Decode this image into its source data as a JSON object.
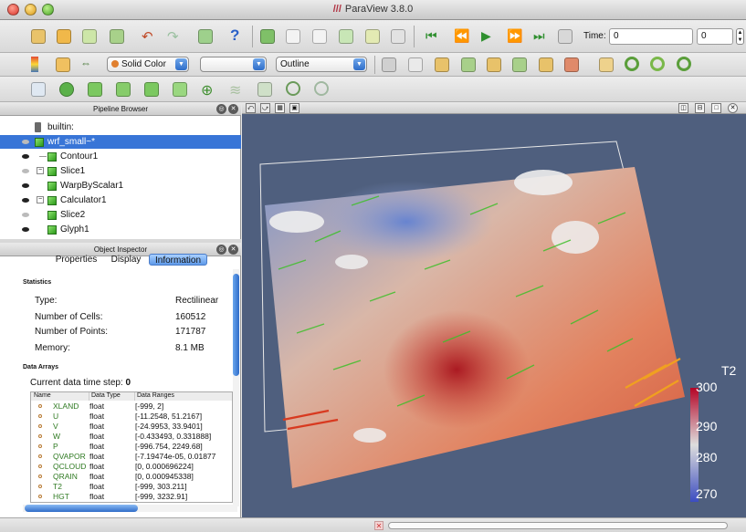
{
  "window": {
    "title": "ParaView 3.8.0"
  },
  "toolbar_main": {
    "time_label": "Time:",
    "time_value": "0",
    "timestep_value": "0",
    "icons": [
      "open-icon",
      "open-folder-icon",
      "load-state-icon",
      "save-state-icon",
      "undo-icon",
      "redo-icon",
      "connect-icon",
      "help-icon",
      "interact-icon",
      "select-cells-icon",
      "select-points-icon",
      "select-frustum-icon",
      "select-block-icon",
      "select-mode-icon",
      "first-frame-icon",
      "previous-frame-icon",
      "play-icon",
      "next-frame-icon",
      "last-frame-icon",
      "loop-icon"
    ]
  },
  "toolbar_display": {
    "color_by": "Solid Color",
    "component": "",
    "representation": "Outline"
  },
  "pipeline": {
    "title": "Pipeline Browser",
    "items": [
      {
        "label": "builtin:",
        "visible": null,
        "selected": false
      },
      {
        "label": "wrf_small~*",
        "visible": false,
        "selected": true
      },
      {
        "label": "Contour1",
        "visible": true,
        "selected": false
      },
      {
        "label": "Slice1",
        "visible": false,
        "selected": false
      },
      {
        "label": "WarpByScalar1",
        "visible": true,
        "selected": false
      },
      {
        "label": "Calculator1",
        "visible": true,
        "selected": false
      },
      {
        "label": "Slice2",
        "visible": false,
        "selected": false
      },
      {
        "label": "Glyph1",
        "visible": true,
        "selected": false
      }
    ]
  },
  "inspector": {
    "title": "Object Inspector",
    "tabs": [
      "Properties",
      "Display",
      "Information"
    ],
    "active_tab": "Information",
    "statistics_title": "Statistics",
    "stats": [
      {
        "label": "Type:",
        "value": "Rectilinear"
      },
      {
        "label": "Number of Cells:",
        "value": "160512"
      },
      {
        "label": "Number of Points:",
        "value": "171787"
      },
      {
        "label": "Memory:",
        "value": "8.1 MB"
      }
    ],
    "arrays_title": "Data Arrays",
    "time_step_label": "Current data time step:",
    "time_step_value": "0",
    "columns": [
      "Name",
      "Data Type",
      "Data Ranges"
    ],
    "arrays": [
      {
        "name": "XLAND",
        "type": "float",
        "range": "[-999, 2]"
      },
      {
        "name": "U",
        "type": "float",
        "range": "[-11.2548, 51.2167]"
      },
      {
        "name": "V",
        "type": "float",
        "range": "[-24.9953, 33.9401]"
      },
      {
        "name": "W",
        "type": "float",
        "range": "[-0.433493, 0.331888]"
      },
      {
        "name": "P",
        "type": "float",
        "range": "[-996.754, 2249.68]"
      },
      {
        "name": "QVAPOR",
        "type": "float",
        "range": "[-7.19474e-05, 0.01877"
      },
      {
        "name": "QCLOUD",
        "type": "float",
        "range": "[0, 0.000696224]"
      },
      {
        "name": "QRAIN",
        "type": "float",
        "range": "[0, 0.000945338]"
      },
      {
        "name": "T2",
        "type": "float",
        "range": "[-999, 303.211]"
      },
      {
        "name": "HGT",
        "type": "float",
        "range": "[-999, 3232.91]"
      }
    ]
  },
  "colorbar": {
    "title": "T2",
    "ticks": [
      "300",
      "290",
      "280",
      "270"
    ],
    "colors": {
      "high": "#b40426",
      "mid": "#dddddd",
      "low": "#3b4cc0"
    }
  },
  "colors": {
    "accent": "#3875d7",
    "viewport_bg": "#4f5f7e"
  }
}
